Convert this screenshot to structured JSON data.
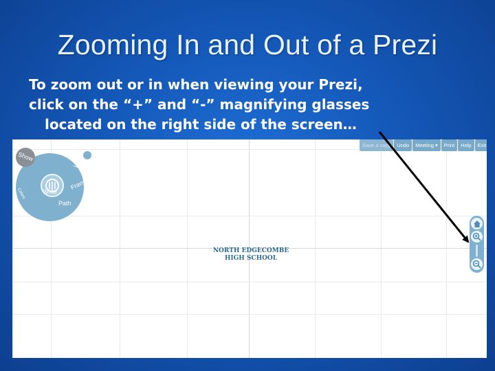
{
  "slide": {
    "title": "Zooming In and Out of a Prezi",
    "body_lines": [
      "To zoom out or in when viewing your Prezi,",
      "click on the “+” and “-” magnifying glasses",
      "located on the right side of the screen…"
    ]
  },
  "prezi": {
    "canvas_title_lines": [
      "NORTH EDGECOMBE",
      "HIGH SCHOOL"
    ],
    "menu": [
      "Save a copy",
      "Undo",
      "Meeting ▾",
      "Print",
      "Help",
      "Exit"
    ],
    "bubble_menu": {
      "center": "Write",
      "insert": "Insert",
      "frame": "Frame",
      "path": "Path",
      "show": "Show",
      "colors": "Colors"
    },
    "side_controls": [
      "home-icon",
      "zoom-in-icon",
      "zoom-out-icon"
    ]
  },
  "colors": {
    "slide_text": "#ffffff",
    "prezi_accent": "#7fb1cf",
    "arrow": "#000000"
  }
}
